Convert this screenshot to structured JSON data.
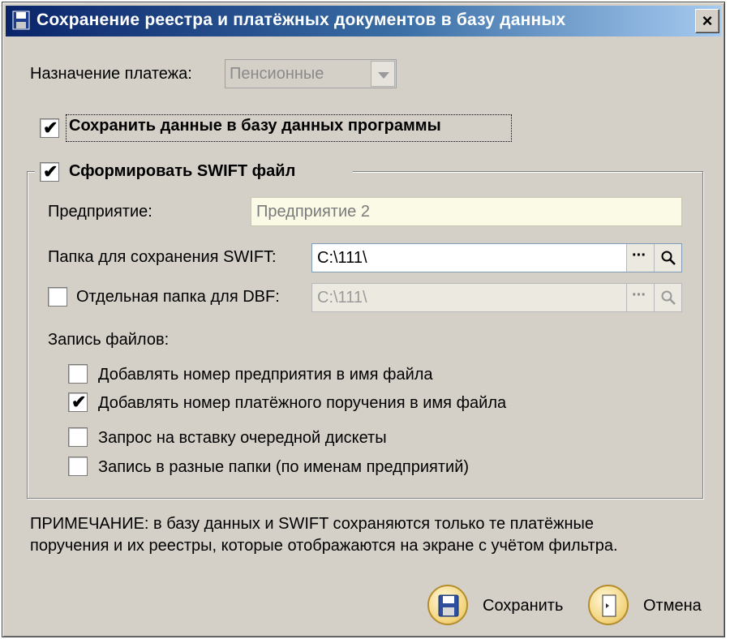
{
  "window": {
    "title": "Сохранение реестра и платёжных документов в базу данных",
    "close_glyph": "×",
    "title_icon": "floppy-disk-icon"
  },
  "payment_purpose": {
    "label": "Назначение платежа:",
    "value": "Пенсионные"
  },
  "save_to_db": {
    "label": "Сохранить данные в базу данных программы",
    "checked": true
  },
  "swift": {
    "label": "Сформировать SWIFT файл",
    "checked": true,
    "enterprise": {
      "label": "Предприятие:",
      "value": "Предприятие 2"
    },
    "folder": {
      "label": "Папка для сохранения SWIFT:",
      "value": "C:\\111\\",
      "browse_glyph": "···"
    },
    "dbf_folder": {
      "label": "Отдельная папка для DBF:",
      "value": "C:\\111\\",
      "checked": false,
      "browse_glyph": "···"
    },
    "file_writing": {
      "label": "Запись файлов:",
      "options": [
        {
          "label": "Добавлять номер предприятия в имя файла",
          "checked": false
        },
        {
          "label": "Добавлять номер платёжного поручения в имя файла",
          "checked": true
        },
        {
          "label": "Запрос на вставку очередной дискеты",
          "checked": false
        },
        {
          "label": "Запись в разные папки (по именам предприятий)",
          "checked": false
        }
      ]
    }
  },
  "note": {
    "line1": "ПРИМЕЧАНИЕ: в базу данных и SWIFT сохраняются только те платёжные",
    "line2": "поручения и их реестры, которые отображаются на экране с учётом фильтра."
  },
  "buttons": {
    "save": {
      "label": "Сохранить",
      "icon": "floppy-disk-icon"
    },
    "cancel": {
      "label": "Отмена",
      "icon": "exit-door-icon"
    }
  },
  "check_glyph": "✔"
}
